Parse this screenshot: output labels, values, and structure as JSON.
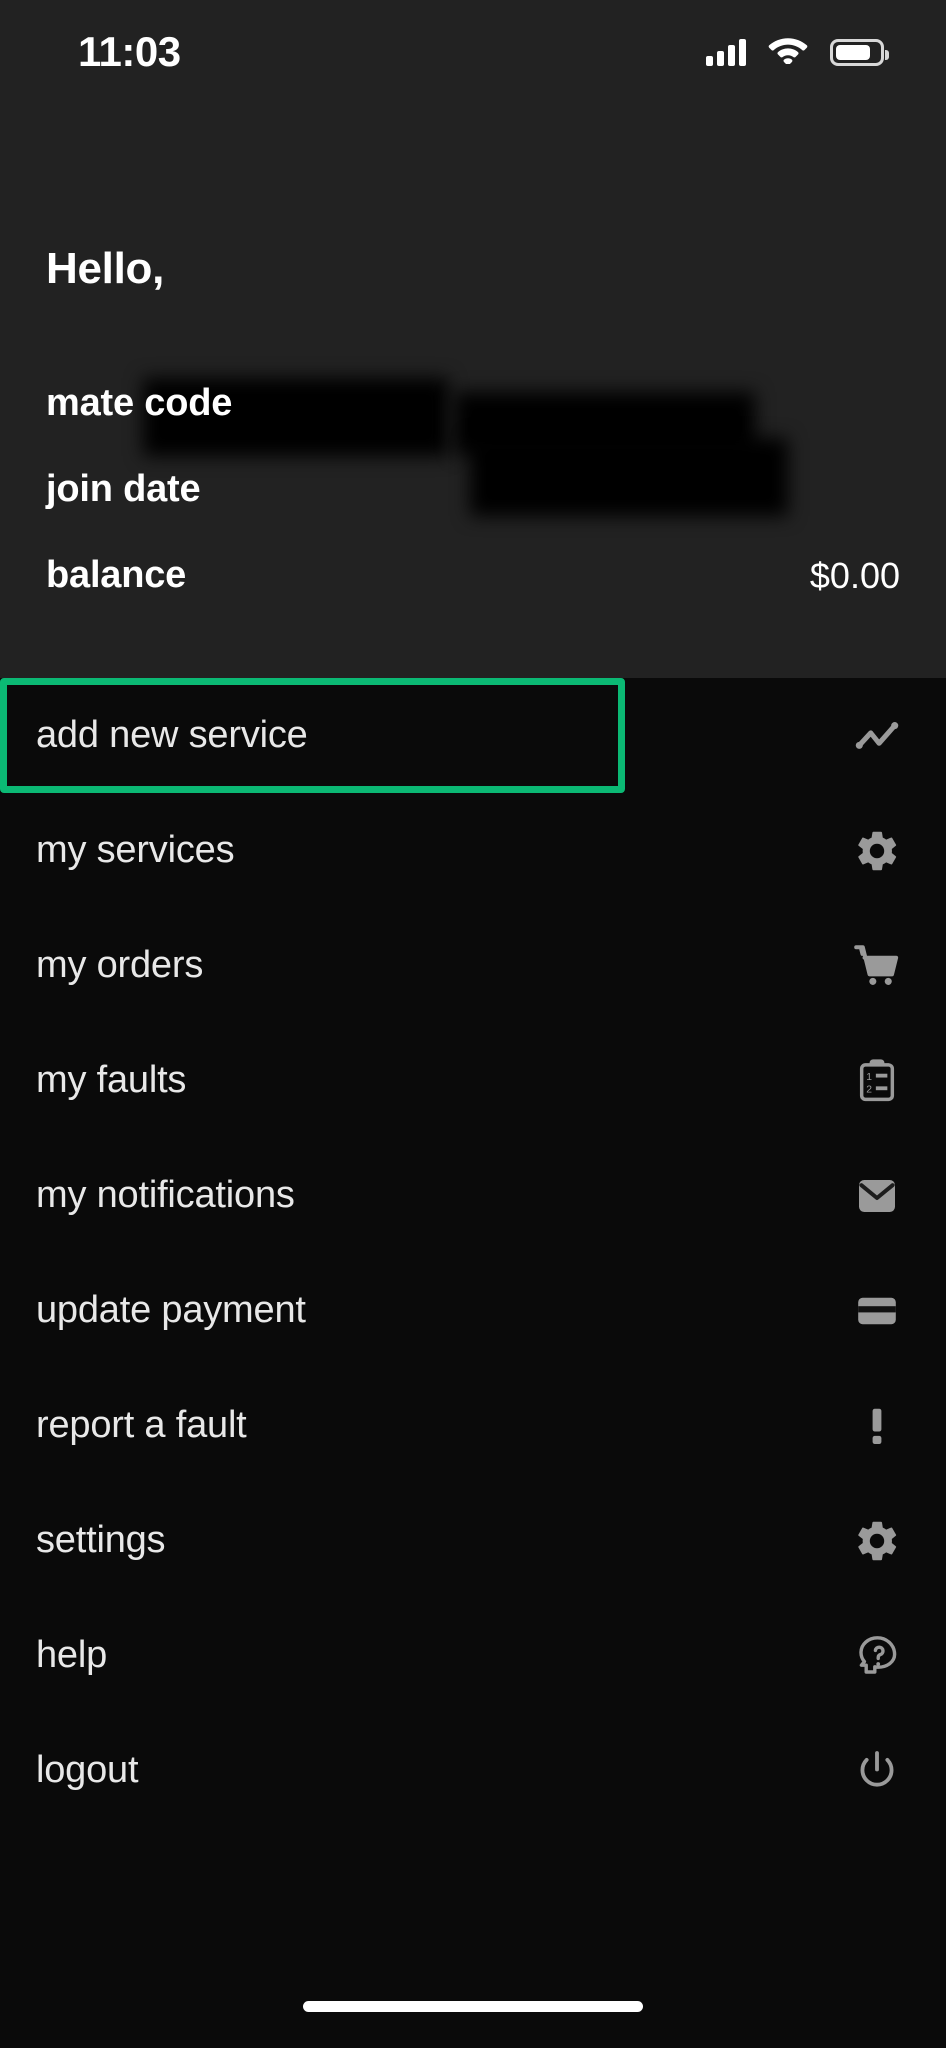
{
  "status_bar": {
    "time": "11:03",
    "signal_icon": "cellular-signal-icon",
    "wifi_icon": "wifi-icon",
    "battery_icon": "battery-icon"
  },
  "header": {
    "greeting": "Hello,",
    "name_redacted": "",
    "rows": [
      {
        "label": "mate code",
        "value": "",
        "redacted": true
      },
      {
        "label": "join date",
        "value": "",
        "redacted": true
      },
      {
        "label": "balance",
        "value": "$0.00",
        "redacted": false
      }
    ]
  },
  "menu": {
    "highlight_color": "#0bb974",
    "items": [
      {
        "label": "add new service",
        "icon": "line-chart-icon",
        "highlighted": true
      },
      {
        "label": "my services",
        "icon": "gear-icon",
        "highlighted": false
      },
      {
        "label": "my orders",
        "icon": "shopping-cart-icon",
        "highlighted": false
      },
      {
        "label": "my faults",
        "icon": "clipboard-list-icon",
        "highlighted": false
      },
      {
        "label": "my notifications",
        "icon": "envelope-icon",
        "highlighted": false
      },
      {
        "label": "update payment",
        "icon": "credit-card-icon",
        "highlighted": false
      },
      {
        "label": "report a fault",
        "icon": "exclamation-icon",
        "highlighted": false
      },
      {
        "label": "settings",
        "icon": "gear-icon",
        "highlighted": false
      },
      {
        "label": "help",
        "icon": "head-question-icon",
        "highlighted": false
      },
      {
        "label": "logout",
        "icon": "power-icon",
        "highlighted": false
      }
    ]
  },
  "home_indicator": "home-indicator"
}
